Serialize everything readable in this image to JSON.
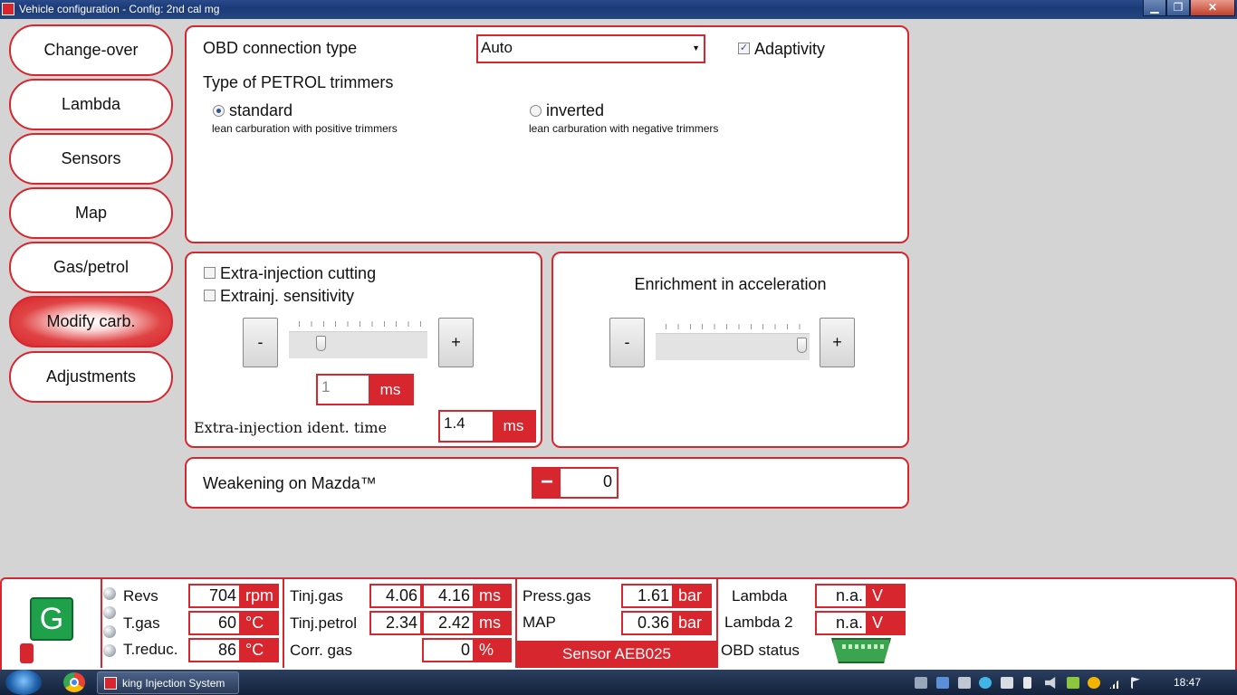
{
  "window": {
    "title": "Vehicle configuration - Config: 2nd cal mg",
    "minimize": "▁",
    "maximize": "❐",
    "close": "✕"
  },
  "nav": {
    "items": [
      {
        "label": "Change-over",
        "active": false
      },
      {
        "label": "Lambda",
        "active": false
      },
      {
        "label": "Sensors",
        "active": false
      },
      {
        "label": "Map",
        "active": false
      },
      {
        "label": "Gas/petrol",
        "active": false
      },
      {
        "label": "Modify carb.",
        "active": true
      },
      {
        "label": "Adjustments",
        "active": false
      }
    ]
  },
  "obd_panel": {
    "connection_label": "OBD connection type",
    "connection_value": "Auto",
    "adaptivity_label": "Adaptivity",
    "adaptivity_checked": true,
    "trimmers_title": "Type of PETROL trimmers",
    "standard_label": "standard",
    "standard_desc": "lean carburation with positive trimmers",
    "standard_selected": true,
    "inverted_label": "inverted",
    "inverted_desc": "lean carburation with negative trimmers",
    "inverted_selected": false
  },
  "extra_panel": {
    "cutting_label": "Extra-injection cutting",
    "cutting_checked": false,
    "sensitivity_label": "Extrainj. sensitivity",
    "sensitivity_checked": false,
    "minus": "-",
    "plus": "+",
    "slider_position": 0.21,
    "value": "1",
    "value_unit": "ms",
    "ident_label": "Extra-injection ident. time",
    "ident_value": "1.4",
    "ident_unit": "ms"
  },
  "enrichment_panel": {
    "title": "Enrichment in acceleration",
    "minus": "-",
    "plus": "+",
    "slider_position": 1.0
  },
  "mazda_panel": {
    "label": "Weakening on Mazda™",
    "minus": "−",
    "value": "0"
  },
  "status_bar": {
    "mode_letter": "G",
    "revs": {
      "label": "Revs",
      "value": "704",
      "unit": "rpm"
    },
    "t_gas": {
      "label": "T.gas",
      "value": "60",
      "unit": "°C"
    },
    "t_reduc": {
      "label": "T.reduc.",
      "value": "86",
      "unit": "°C"
    },
    "tinj_gas": {
      "label": "Tinj.gas",
      "value1": "4.06",
      "value2": "4.16",
      "unit": "ms"
    },
    "tinj_petrol": {
      "label": "Tinj.petrol",
      "value1": "2.34",
      "value2": "2.42",
      "unit": "ms"
    },
    "corr_gas": {
      "label": "Corr. gas",
      "value": "0",
      "unit": "%"
    },
    "press_gas": {
      "label": "Press.gas",
      "value": "1.61",
      "unit": "bar"
    },
    "map": {
      "label": "MAP",
      "value": "0.36",
      "unit": "bar"
    },
    "sensor": "Sensor AEB025",
    "lambda": {
      "label": "Lambda",
      "value": "n.a.",
      "unit": "V"
    },
    "lambda2": {
      "label": "Lambda 2",
      "value": "n.a.",
      "unit": "V"
    },
    "obd_status_label": "OBD status",
    "obd_icon": "obd-connector-icon"
  },
  "taskbar": {
    "task_label": "king Injection System",
    "clock": "18:47"
  },
  "colors": {
    "accent": "#d8262e",
    "gas_badge": "#1fa04a",
    "panel_bg": "#ffffff",
    "window_bg": "#d4d4d4"
  }
}
